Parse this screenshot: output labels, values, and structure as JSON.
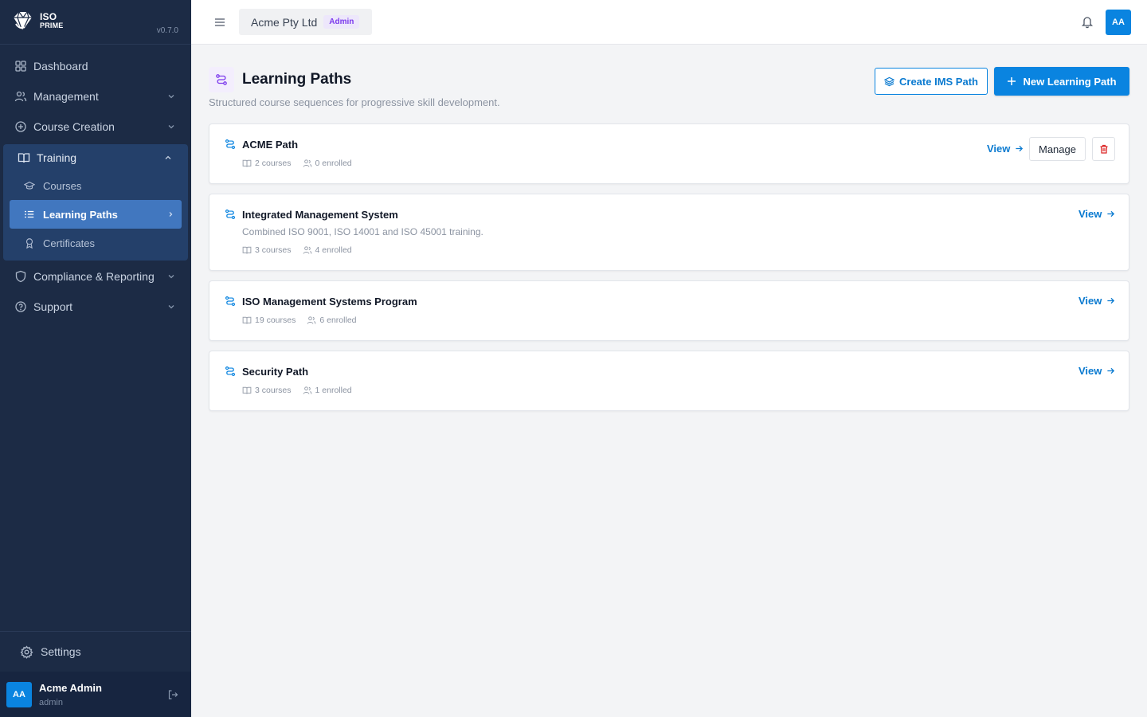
{
  "brand": {
    "logo_line1": "ISO",
    "logo_line2": "PRIME",
    "version": "v0.7.0"
  },
  "sidebar": {
    "items": [
      {
        "label": "Dashboard",
        "icon": "grid-icon"
      },
      {
        "label": "Management",
        "icon": "users-icon"
      },
      {
        "label": "Course Creation",
        "icon": "plus-circle-icon"
      }
    ],
    "training": {
      "label": "Training",
      "icon": "book-open-icon",
      "children": [
        {
          "label": "Courses",
          "icon": "graduation-cap-icon"
        },
        {
          "label": "Learning Paths",
          "icon": "list-icon",
          "active": true
        },
        {
          "label": "Certificates",
          "icon": "award-icon"
        }
      ]
    },
    "items_after": [
      {
        "label": "Compliance & Reporting",
        "icon": "shield-icon"
      },
      {
        "label": "Support",
        "icon": "help-circle-icon"
      }
    ],
    "settings_label": "Settings",
    "user": {
      "initials": "AA",
      "name": "Acme Admin",
      "role": "admin"
    }
  },
  "topbar": {
    "org_name": "Acme Pty Ltd",
    "role_badge": "Admin",
    "avatar_initials": "AA"
  },
  "page": {
    "title": "Learning Paths",
    "subtitle": "Structured course sequences for progressive skill development.",
    "create_ims_label": "Create IMS Path",
    "new_path_label": "New Learning Path"
  },
  "paths": [
    {
      "title": "ACME Path",
      "description": "",
      "courses": "2 courses",
      "enrolled": "0 enrolled",
      "view_label": "View",
      "manage_label": "Manage"
    },
    {
      "title": "Integrated Management System",
      "description": "Combined ISO 9001, ISO 14001 and ISO 45001 training.",
      "courses": "3 courses",
      "enrolled": "4 enrolled",
      "view_label": "View"
    },
    {
      "title": "ISO Management Systems Program",
      "description": "",
      "courses": "19 courses",
      "enrolled": "6 enrolled",
      "view_label": "View"
    },
    {
      "title": "Security Path",
      "description": "",
      "courses": "3 courses",
      "enrolled": "1 enrolled",
      "view_label": "View"
    }
  ],
  "colors": {
    "sidebar_bg": "#1c2b45",
    "active_item": "#4177bf",
    "accent": "#0a84e0",
    "badge_purple": "#7c3aed",
    "danger": "#dc2626"
  }
}
